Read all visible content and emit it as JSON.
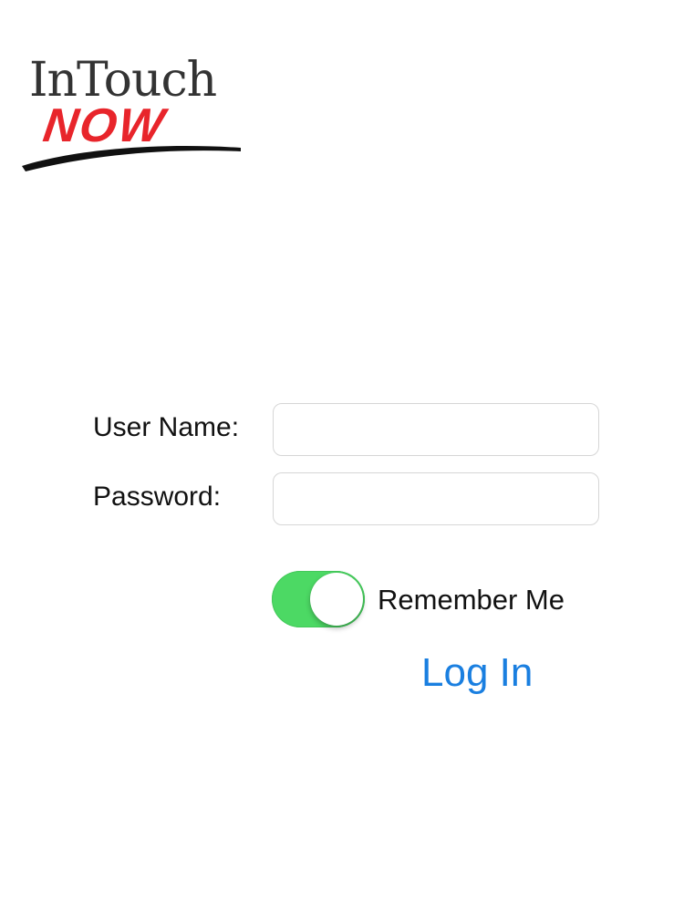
{
  "logo": {
    "line1": "InTouch",
    "line2": "NOW"
  },
  "form": {
    "username_label": "User Name:",
    "username_value": "",
    "username_placeholder": "",
    "password_label": "Password:",
    "password_value": "",
    "password_placeholder": "",
    "remember_label": "Remember Me",
    "remember_on": true,
    "login_label": "Log In"
  },
  "colors": {
    "toggle_on": "#4cd964",
    "link_blue": "#1a7fe0",
    "logo_red": "#e8252b",
    "logo_gray": "#333333"
  },
  "icons": {
    "logo_swoosh": "swoosh-underline"
  }
}
